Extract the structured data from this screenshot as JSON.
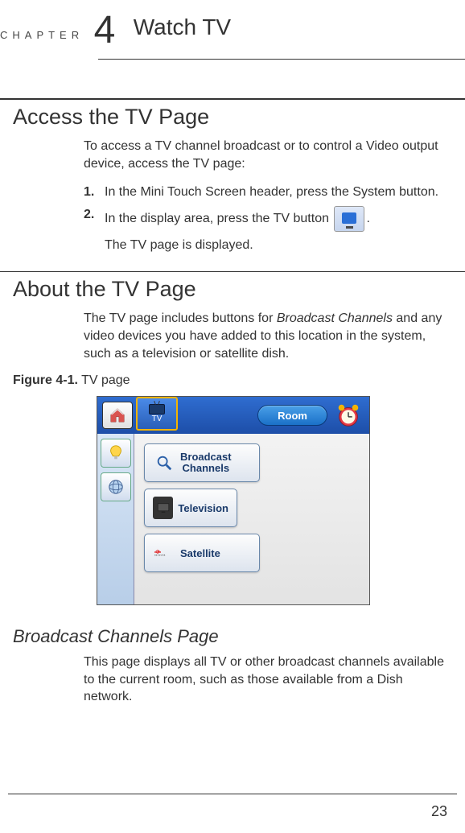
{
  "chapter": {
    "label": "CHAPTER",
    "number": "4",
    "title": "Watch TV"
  },
  "section1": {
    "heading": "Access the TV Page",
    "intro": "To access a TV channel broadcast or to control a Video output device, access the TV page:",
    "step1_num": "1.",
    "step1_text": "In the Mini Touch Screen header, press the System button.",
    "step2_num": "2.",
    "step2_text_a": "In the display area, press the TV button",
    "step2_text_b": ".",
    "step2_after": "The TV page is displayed."
  },
  "section2": {
    "heading": "About the TV Page",
    "intro_a": "The TV page includes buttons for ",
    "intro_em": "Broadcast Channels",
    "intro_b": " and any video devices you have added to this location in the system, such as a television or satellite dish."
  },
  "figure": {
    "label_bold": "Figure 4-1.",
    "label_rest": " TV page"
  },
  "ui": {
    "tv_tab": "TV",
    "room": "Room",
    "btn_broadcast": "Broadcast\nChannels",
    "btn_television": "Television",
    "btn_satellite": "Satellite"
  },
  "section3": {
    "heading": "Broadcast Channels Page",
    "body": "This page displays all TV or other broadcast channels available to the current room, such as those available from a Dish network."
  },
  "page_number": "23"
}
